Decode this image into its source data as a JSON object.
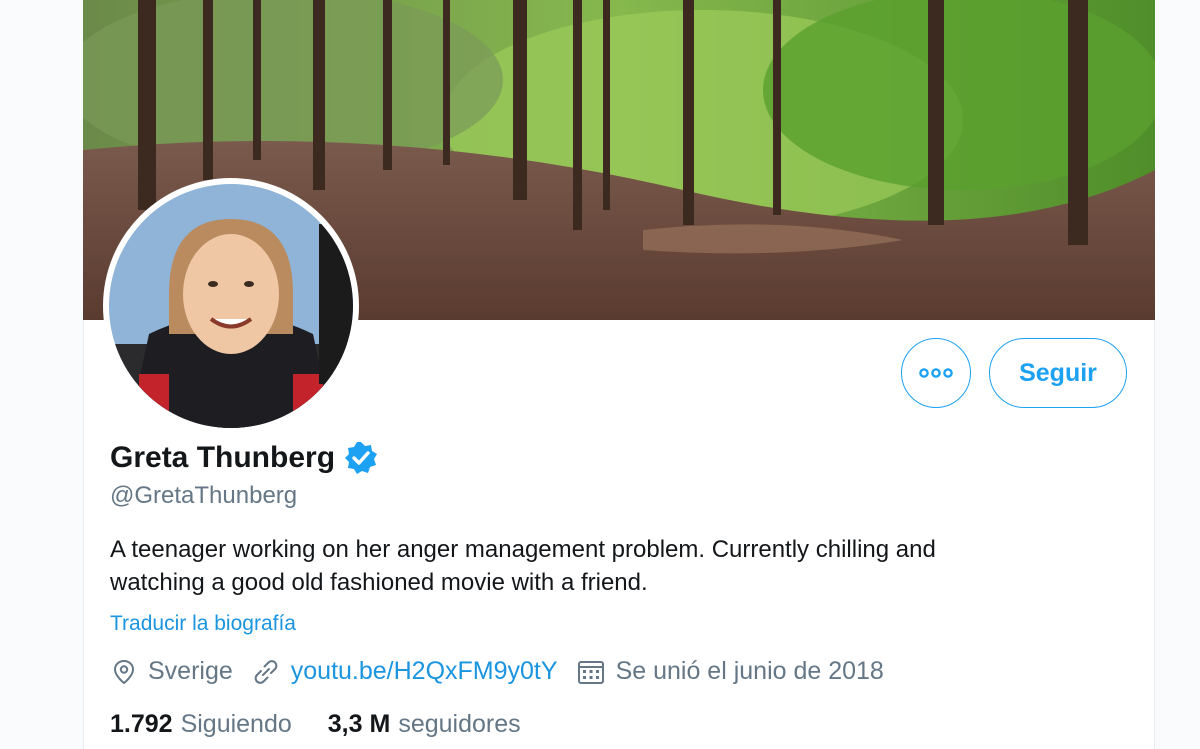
{
  "profile": {
    "name": "Greta Thunberg",
    "handle": "@GretaThunberg",
    "bio_line1": "A teenager working on her anger management problem. Currently chilling and",
    "bio_line2": "watching a good old fashioned movie with a friend.",
    "translate_label": "Traducir la biografía",
    "location": "Sverige",
    "website": "youtu.be/H2QxFM9y0tY",
    "joined": "Se unió el junio de 2018",
    "following_count": "1.792",
    "following_label": "Siguiendo",
    "followers_count": "3,3 M",
    "followers_label": "seguidores",
    "verified": true
  },
  "actions": {
    "follow_label": "Seguir",
    "more_icon": "ellipsis-icon"
  },
  "icons": {
    "location": "location-pin-icon",
    "link": "link-icon",
    "calendar": "calendar-icon",
    "verified": "verified-badge-icon"
  },
  "colors": {
    "accent": "#1da1f2",
    "link": "#1b95e0",
    "text": "#14171a",
    "secondary_text": "#657786"
  }
}
